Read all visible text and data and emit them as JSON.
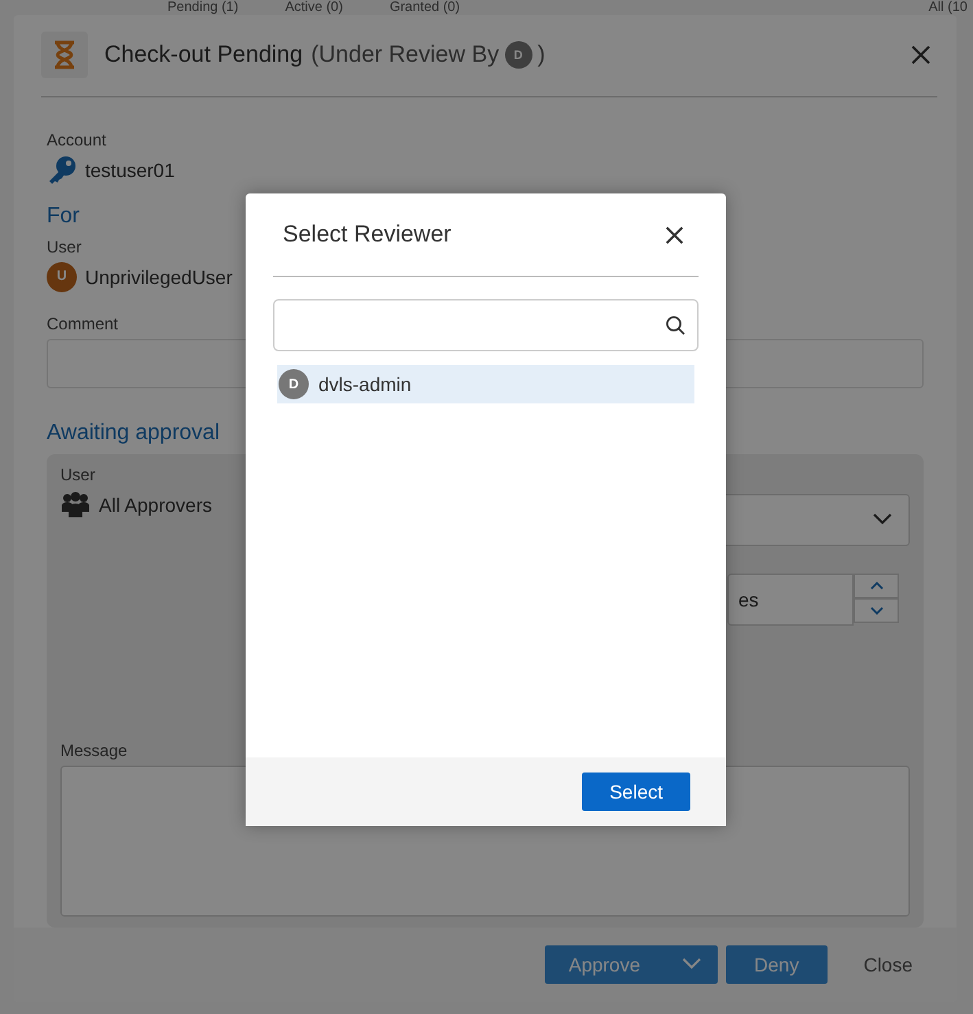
{
  "background_tabs": [
    {
      "label": "Pending (1)"
    },
    {
      "label": "Active (0)"
    },
    {
      "label": "Granted (0)"
    },
    {
      "label": "All (10"
    }
  ],
  "dialog": {
    "title": "Check-out Pending",
    "title_note_open": "(Under Review By",
    "reviewer_initial": "D",
    "title_note_close": ")",
    "account": {
      "label": "Account",
      "value": "testuser01"
    },
    "for_heading": "For",
    "user": {
      "label": "User",
      "initial": "U",
      "name": "UnprivilegedUser"
    },
    "comment": {
      "label": "Comment"
    },
    "awaiting_heading": "Awaiting approval",
    "approver": {
      "label": "User",
      "name": "All Approvers"
    },
    "duration_field": {
      "value": "es"
    },
    "message": {
      "label": "Message"
    },
    "buttons": {
      "approve": "Approve",
      "deny": "Deny",
      "close": "Close"
    }
  },
  "modal": {
    "title": "Select Reviewer",
    "reviewers": [
      {
        "initial": "D",
        "name": "dvls-admin",
        "selected": true
      }
    ],
    "select_button": "Select"
  }
}
